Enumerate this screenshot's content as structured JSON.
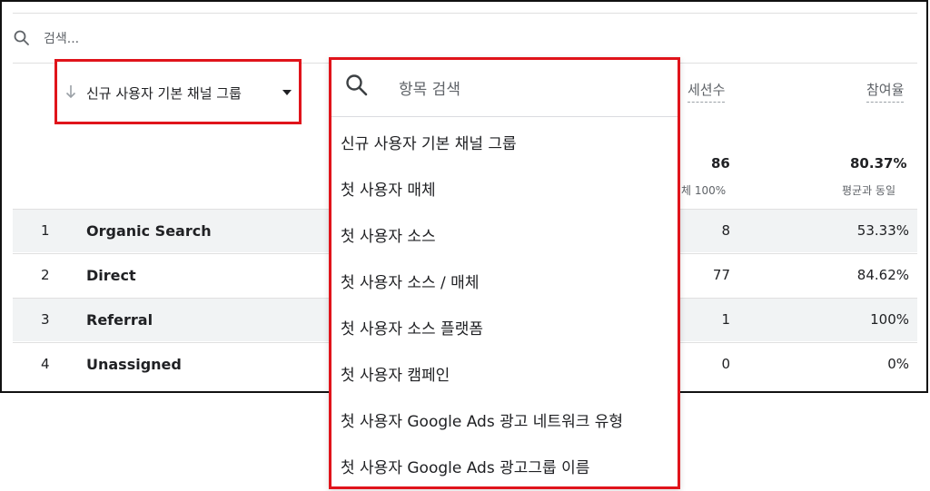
{
  "search": {
    "placeholder": "검색..."
  },
  "dimension": {
    "label": "신규 사용자 기본 채널 그룹"
  },
  "metrics": {
    "sessions": {
      "header": "세션수",
      "total": "86",
      "total_sub": "체 100%"
    },
    "engagement": {
      "header": "참여율",
      "total": "80.37%",
      "total_sub": "평균과 동일"
    }
  },
  "rows": [
    {
      "index": "1",
      "name": "Organic Search",
      "sessions": "8",
      "engagement": "53.33%"
    },
    {
      "index": "2",
      "name": "Direct",
      "sessions": "77",
      "engagement": "84.62%"
    },
    {
      "index": "3",
      "name": "Referral",
      "sessions": "1",
      "engagement": "100%"
    },
    {
      "index": "4",
      "name": "Unassigned",
      "sessions": "0",
      "engagement": "0%"
    }
  ],
  "dropdown": {
    "search_placeholder": "항목 검색",
    "items": [
      "신규 사용자 기본 채널 그룹",
      "첫 사용자 매체",
      "첫 사용자 소스",
      "첫 사용자 소스 / 매체",
      "첫 사용자 소스 플랫폼",
      "첫 사용자 캠페인",
      "첫 사용자 Google Ads 광고 네트워크 유형",
      "첫 사용자 Google Ads 광고그룹 이름"
    ]
  },
  "colors": {
    "highlight": "#e0141b",
    "row_shade": "#f1f3f4",
    "text": "#202124",
    "muted": "#5f6368"
  }
}
